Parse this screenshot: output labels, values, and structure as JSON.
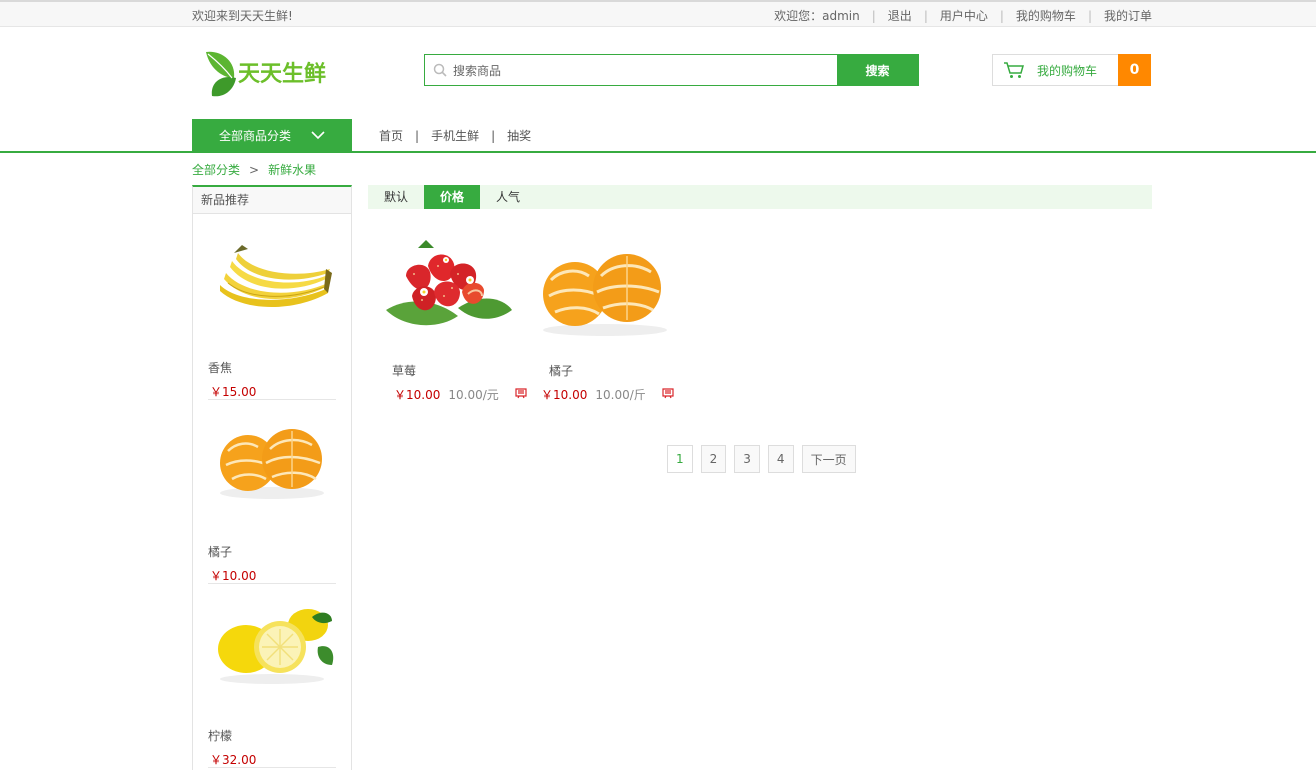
{
  "topbar": {
    "welcome": "欢迎来到天天生鲜!",
    "user_greeting": "欢迎您：admin",
    "logout": "退出",
    "user_center": "用户中心",
    "my_cart": "我的购物车",
    "my_orders": "我的订单"
  },
  "header": {
    "logo_text": "天天生鲜",
    "search_placeholder": "搜索商品",
    "search_button": "搜索",
    "cart_label": "我的购物车",
    "cart_count": "0"
  },
  "nav": {
    "all_categories": "全部商品分类",
    "links": [
      "首页",
      "手机生鲜",
      "抽奖"
    ]
  },
  "breadcrumb": {
    "root": "全部分类",
    "arrow": ">",
    "current": "新鲜水果"
  },
  "sidebar": {
    "title": "新品推荐",
    "items": [
      {
        "name": "香焦",
        "price": "￥15.00",
        "icon": "banana"
      },
      {
        "name": "橘子",
        "price": "￥10.00",
        "icon": "orange"
      },
      {
        "name": "柠檬",
        "price": "￥32.00",
        "icon": "lemon"
      }
    ]
  },
  "sort": {
    "tabs": [
      "默认",
      "价格",
      "人气"
    ],
    "active": "价格"
  },
  "products": [
    {
      "name": "草莓",
      "price": "￥10.00",
      "unit": "10.00/元",
      "icon": "strawberry"
    },
    {
      "name": "橘子",
      "price": "￥10.00",
      "unit": "10.00/斤",
      "icon": "orange"
    }
  ],
  "pagination": {
    "pages": [
      "1",
      "2",
      "3",
      "4"
    ],
    "next": "下一页",
    "current": "1"
  },
  "colors": {
    "brand_green": "#37ab40",
    "price_red": "#c40000",
    "cart_orange": "#ff8800"
  }
}
